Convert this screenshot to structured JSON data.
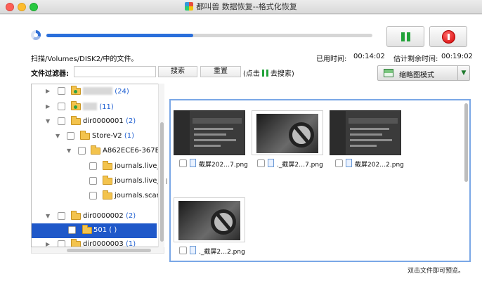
{
  "window": {
    "title": "都叫兽 数据恢复--格式化恢复"
  },
  "progress": {
    "fraction": 0.45
  },
  "status": {
    "scan_text": "扫描/Volumes/DISK2/中的文件。",
    "elapsed_label": "已用时间:",
    "elapsed_value": "00:14:02",
    "remaining_label": "估计剩余时间:",
    "remaining_value": "00:19:02"
  },
  "filter": {
    "label": "文件过滤器:",
    "value": "",
    "search_label": "搜索",
    "reset_label": "重置",
    "hint_before": "(点击",
    "hint_after": "去搜索)"
  },
  "view_mode": {
    "label": "缩略图模式"
  },
  "tree": {
    "rows": [
      {
        "label": "",
        "count": "(24)"
      },
      {
        "label": "",
        "count": "(11)"
      },
      {
        "label": "dir0000001",
        "count": "(2)"
      },
      {
        "label": "Store-V2",
        "count": "(1)"
      },
      {
        "label": "A862ECE6-367E",
        "count": ""
      },
      {
        "label": "journals.live_",
        "count": ""
      },
      {
        "label": "journals.live_",
        "count": ""
      },
      {
        "label": "journals.scan",
        "count": ""
      },
      {
        "label": "dir0000002",
        "count": "(2)"
      },
      {
        "label": "501",
        "count": "( )"
      },
      {
        "label": "dir0000003",
        "count": "(1)"
      }
    ]
  },
  "grid": {
    "items": [
      {
        "name": "截屏202…7.png",
        "kind": "screenshot"
      },
      {
        "name": "._截屏2…7.png",
        "kind": "placeholder"
      },
      {
        "name": "截屏202…2.png",
        "kind": "screenshot"
      },
      {
        "name": "._截屏2…2.png",
        "kind": "placeholder"
      }
    ]
  },
  "footer": {
    "hint": "双击文件即可预览。"
  }
}
